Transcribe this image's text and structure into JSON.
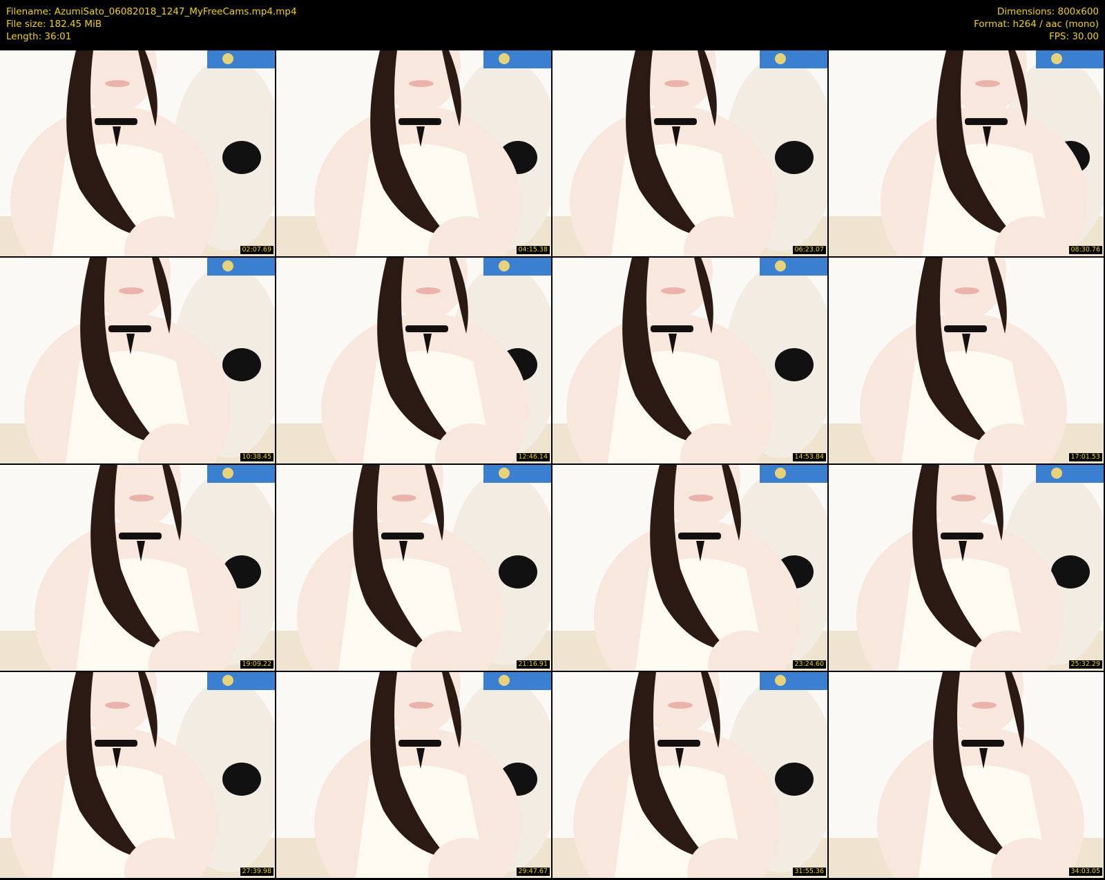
{
  "header": {
    "filename_line": "Filename: AzumiSato_06082018_1247_MyFreeCams.mp4.mp4",
    "filesize_line": "File size: 182.45 MiB",
    "length_line": "Length: 36:01",
    "dimensions_line": "Dimensions: 800x600",
    "format_line": "Format: h264 / aac (mono)",
    "fps_line": "FPS: 30.00"
  },
  "colors": {
    "background": "#000000",
    "header_text": "#f0d400",
    "hair": "#2b1a14",
    "skin": "#f7e7dc",
    "top_fabric": "#fdfaf1"
  },
  "thumbnails": [
    {
      "timestamp": "02:07.69",
      "icon": "video-frame-thumbnail"
    },
    {
      "timestamp": "04:15.38",
      "icon": "video-frame-thumbnail"
    },
    {
      "timestamp": "06:23.07",
      "icon": "video-frame-thumbnail"
    },
    {
      "timestamp": "08:30.76",
      "icon": "video-frame-thumbnail"
    },
    {
      "timestamp": "10:38.45",
      "icon": "video-frame-thumbnail"
    },
    {
      "timestamp": "12:46.14",
      "icon": "video-frame-thumbnail"
    },
    {
      "timestamp": "14:53.84",
      "icon": "video-frame-thumbnail"
    },
    {
      "timestamp": "17:01.53",
      "icon": "video-frame-thumbnail"
    },
    {
      "timestamp": "19:09.22",
      "icon": "video-frame-thumbnail"
    },
    {
      "timestamp": "21:16.91",
      "icon": "video-frame-thumbnail"
    },
    {
      "timestamp": "23:24.60",
      "icon": "video-frame-thumbnail"
    },
    {
      "timestamp": "25:32.29",
      "icon": "video-frame-thumbnail"
    },
    {
      "timestamp": "27:39.98",
      "icon": "video-frame-thumbnail"
    },
    {
      "timestamp": "29:47.67",
      "icon": "video-frame-thumbnail"
    },
    {
      "timestamp": "31:55.36",
      "icon": "video-frame-thumbnail"
    },
    {
      "timestamp": "34:03.05",
      "icon": "video-frame-thumbnail"
    }
  ]
}
